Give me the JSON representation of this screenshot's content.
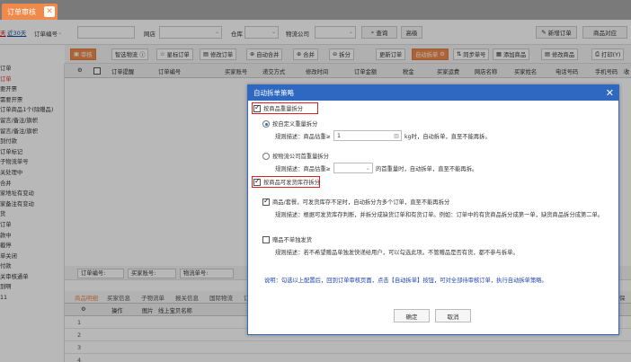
{
  "tab": {
    "title": "订单审核",
    "close": "✕"
  },
  "filter": {
    "link_day": "天",
    "link_30": "近30天",
    "order_no_label": "订单编号",
    "shop_label": "网店",
    "warehouse_label": "仓库",
    "logistics_label": "物流公司",
    "query": "查询",
    "advanced": "高级",
    "new_order": "新增订单",
    "product_compare": "商品对应"
  },
  "leftnav": [
    "订单",
    "订单",
    "要开票",
    "需要开票",
    "订单商品1个(除赠品)",
    "留言/备注/旗帜",
    "留言/备注/旗帜",
    "到付款",
    "订单标记",
    "子物流单号",
    "关处理中",
    "合并",
    "家地址有变动",
    "家备注有变动",
    "货",
    "订单",
    "款中",
    "截停",
    "单关闭",
    "付款",
    "关审核通单",
    "到啊",
    "11"
  ],
  "toolbar": {
    "audit": "审核",
    "smart_logistics": "智选物流",
    "star_mark": "星标订单",
    "modify_order": "修改订单",
    "auto_merge": "自动合并",
    "merge": "合并",
    "split": "拆分",
    "update_order": "更新订单",
    "auto_split": "自动拆单",
    "sync_no": "同步单号",
    "add_product": "添加商品",
    "modify_product": "修改商品",
    "print": "打印(Y)"
  },
  "grid_headers": [
    "订单提醒",
    "订单编号",
    "买家账号",
    "递交方式",
    "修改时间",
    "订单金额",
    "税金",
    "买家运费",
    "网店名称",
    "买家姓名",
    "电话号码",
    "手机号码",
    "收"
  ],
  "lower": {
    "order_no": "订单编号:",
    "buyer_acct": "买家账号:",
    "logistics_no": "物流单号:",
    "tabs": [
      "商品明细",
      "买家信息",
      "子物流单",
      "报关信息",
      "国际物流",
      "订"
    ],
    "sub_headers": {
      "operation": "操作",
      "image": "图片",
      "online_name": "线上宝贝名称"
    },
    "rows": [
      "1",
      "2",
      "3",
      "4"
    ],
    "right_cut": "保"
  },
  "dialog": {
    "title": "自动拆单策略",
    "close": "✕",
    "by_weight": "按商品重量拆分",
    "custom_weight": "按自定义重量拆分",
    "rule_label": "规则描述：商品估重≥",
    "weight_value": "1",
    "rule_tail": "kg时，自动拆单，直至不能再拆。",
    "by_logistics_weight": "按物流公司首重量拆分",
    "rule_label2": "规则描述：商品估重≥",
    "rule_tail2": "的首重量时，自动拆单，直至不能再拆。",
    "by_stock": "按商品可发货库存拆分",
    "stock_rule": "商品/套餐，可发货库存不足时，自动拆分为多个订单，直至不能再拆分",
    "stock_desc": "规则描述：根据可发货库存判断，并拆分成缺货订单和有货订单。例如：订单中的有货商品拆分成第一单，缺货商品拆分成第二单。",
    "gift_nosplit": "赠品不单独发货",
    "gift_desc": "规则描述：若不希望赠品单独发快递给用户，可以勾选此项。不管赠品是否有货，都不参与拆单。",
    "note": "说明：勾选以上配置后，回到订单审核页面，点击【自动拆单】按钮，可对全部待审核订单，执行自动拆单策略。",
    "ok": "确定",
    "cancel": "取消"
  },
  "colors": {
    "accent": "#f08a4b",
    "dialog_blue": "#2f68c0",
    "highlight_red": "#e02020"
  }
}
